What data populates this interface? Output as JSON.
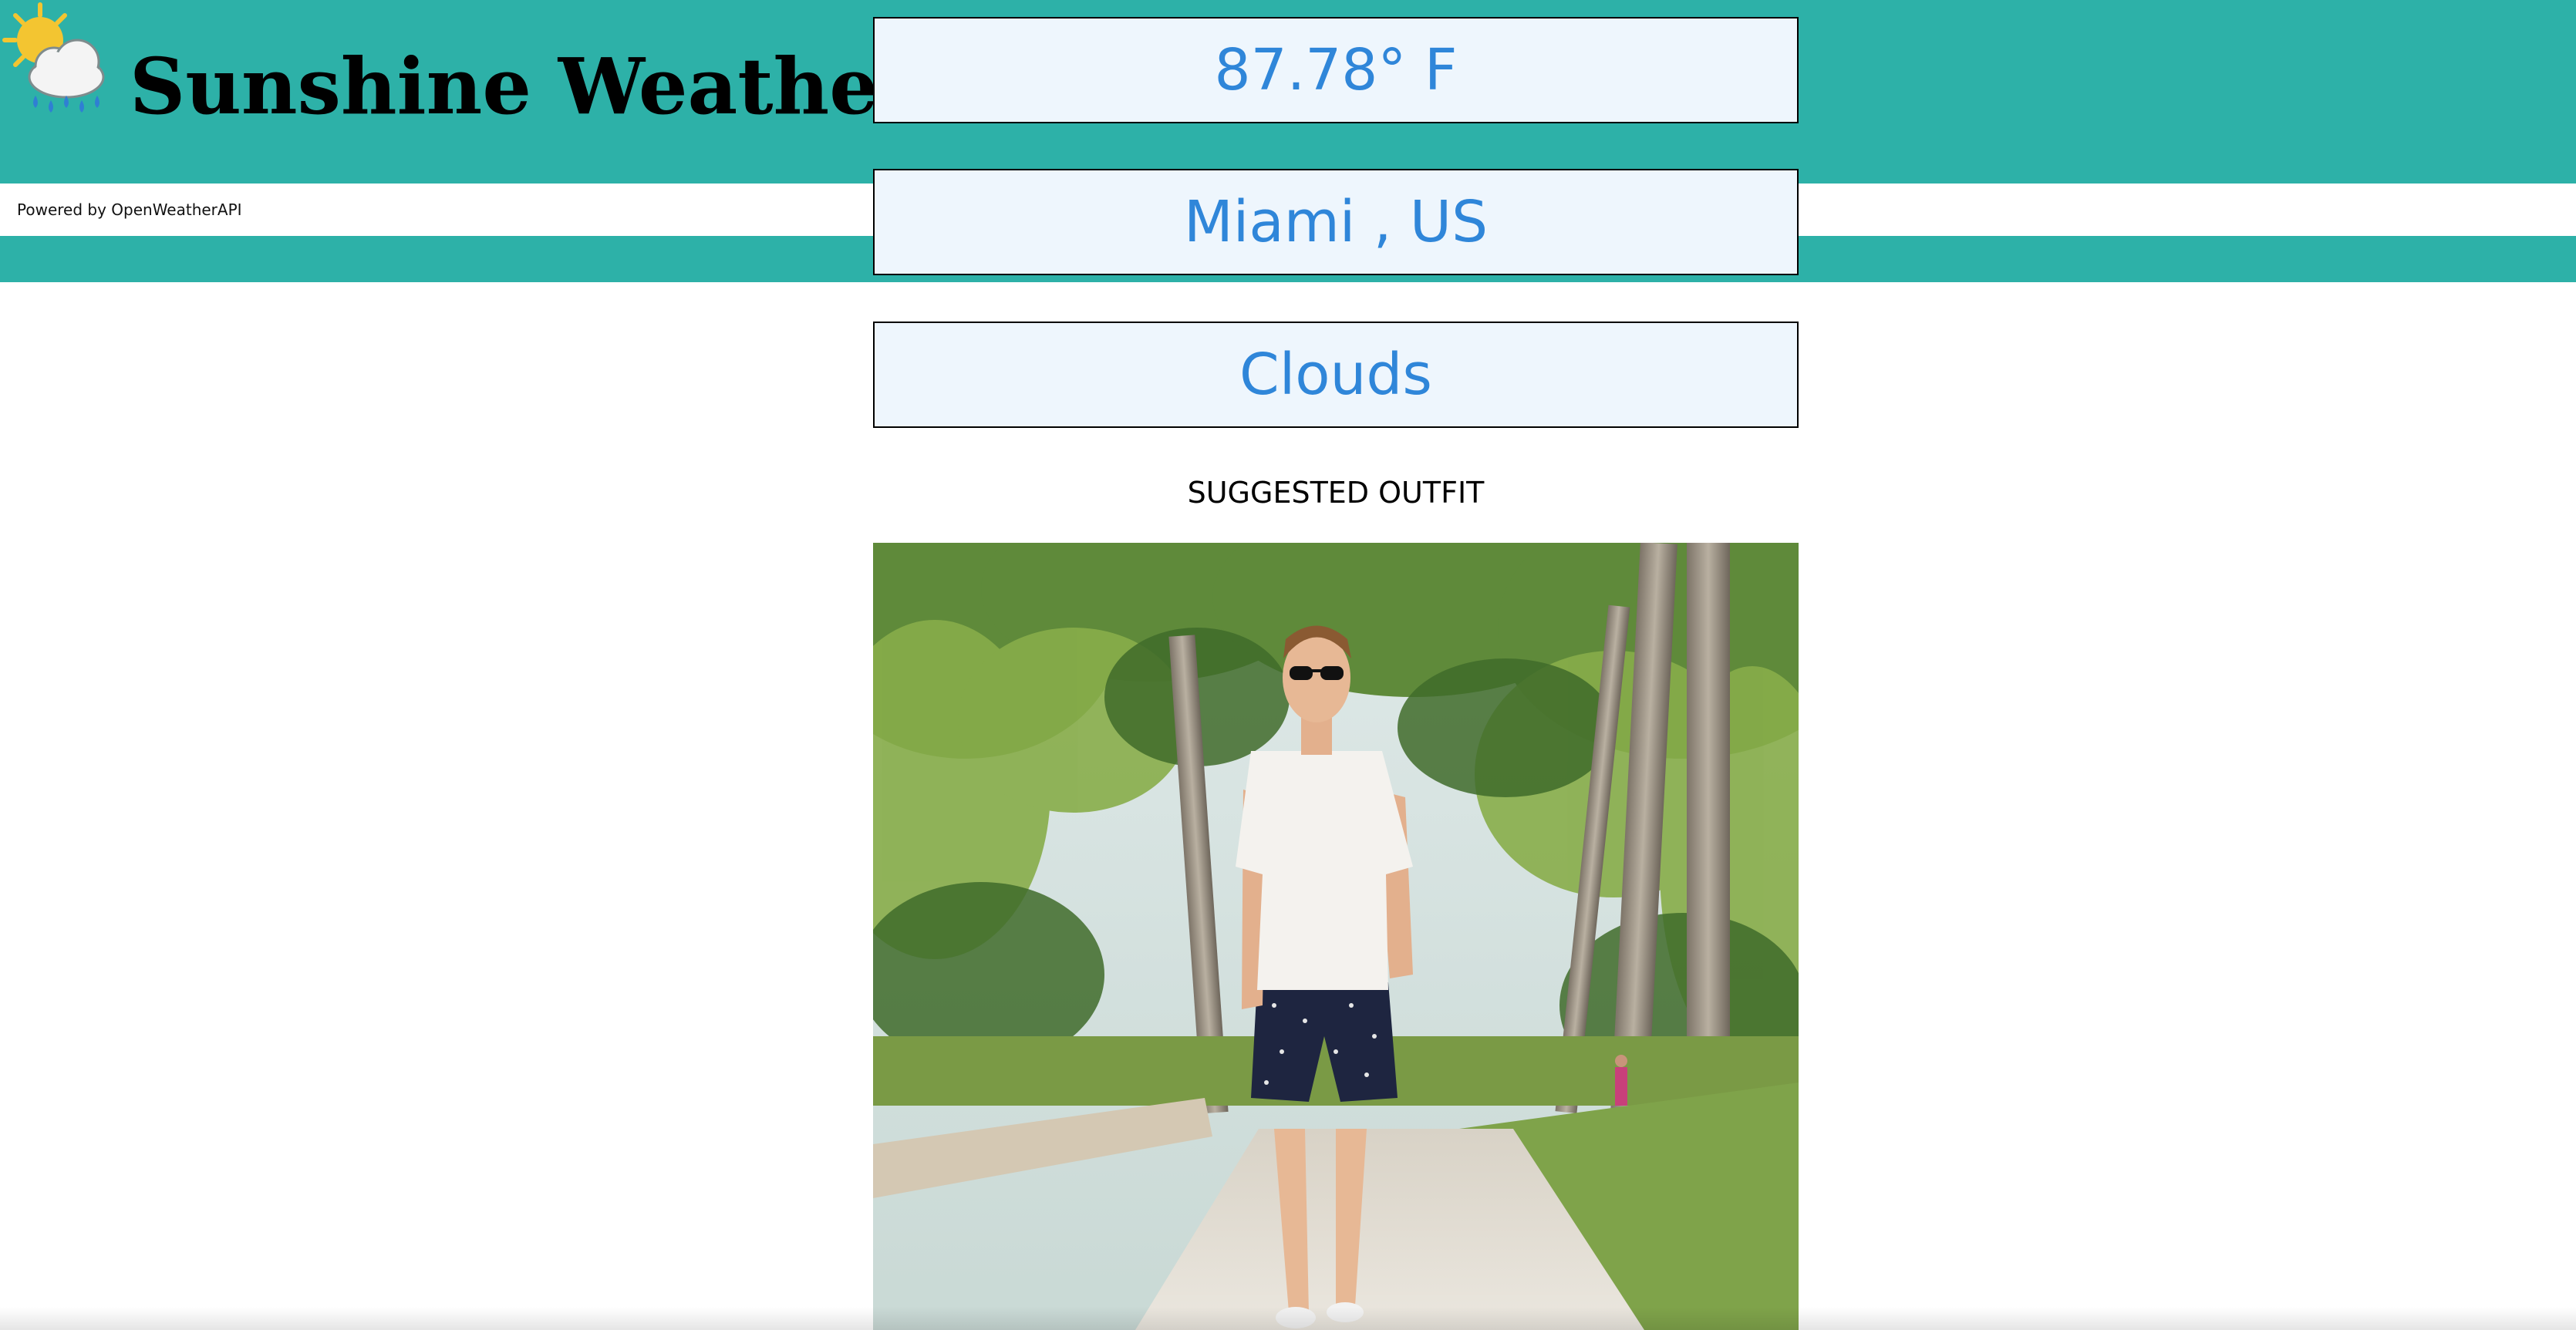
{
  "header": {
    "title": "Sunshine Weather",
    "logo_icon": "sun-cloud-rain-icon",
    "background_color": "#2db1a8"
  },
  "attribution": {
    "text": "Powered by OpenWeatherAPI"
  },
  "weather": {
    "temperature": "87.78° F",
    "location": "Miami , US",
    "condition": "Clouds",
    "box_background": "#eef6fd",
    "text_color": "#2f86d9"
  },
  "outfit": {
    "heading": "SUGGESTED OUTFIT"
  }
}
